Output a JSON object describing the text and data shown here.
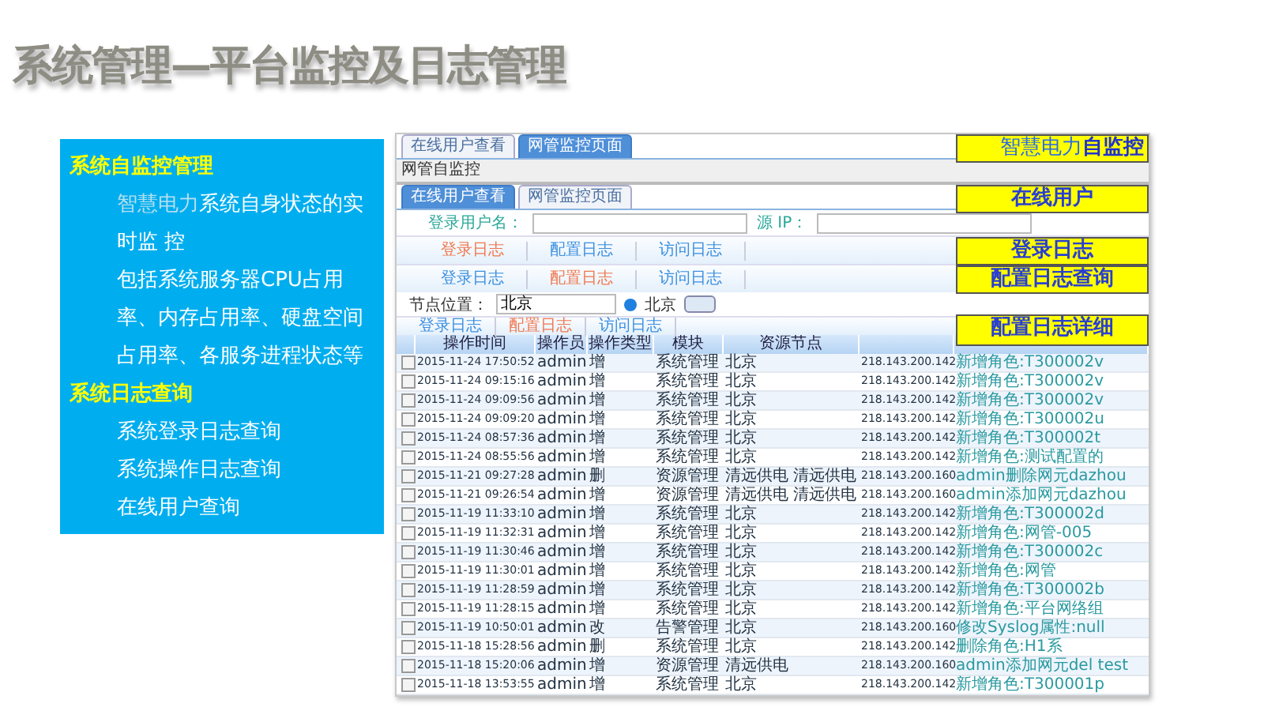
{
  "title": "系统管理—平台监控及日志管理",
  "panel": {
    "sections": [
      {
        "heading": "系统自监控管理",
        "items": [
          {
            "highlight": "智慧电力",
            "text": "系统自身状态的实时监 控"
          },
          {
            "text": "包括系统服务器CPU占用率、内存占用率、硬盘空间占用率、各服务进程状态等"
          }
        ]
      },
      {
        "heading": "系统日志查询",
        "items": [
          {
            "text": "系统登录日志查询"
          },
          {
            "text": "系统操作日志查询"
          },
          {
            "text": "在线用户查询"
          }
        ]
      }
    ]
  },
  "screenshot": {
    "top_tabs": {
      "tabs": [
        {
          "label": "在线用户查看",
          "selected": false
        },
        {
          "label": "网管监控页面",
          "selected": true
        }
      ],
      "callout": "智慧电力**自监控**"
    },
    "breadcrumb": "网管自监控",
    "sub_tabs": {
      "tabs": [
        {
          "label": "在线用户查看",
          "selected": true
        },
        {
          "label": "网管监控页面",
          "selected": false
        }
      ],
      "callout": "在线用户"
    },
    "filters": [
      {
        "label": "登录用户名："
      },
      {
        "label": "源 IP："
      }
    ],
    "log_tabs_1": {
      "tabs": [
        {
          "label": "登录日志",
          "selected": true
        },
        {
          "label": "配置日志",
          "selected": false
        },
        {
          "label": "访问日志",
          "selected": false
        }
      ],
      "callout": "登录日志"
    },
    "log_tabs_2": {
      "tabs": [
        {
          "label": "登录日志",
          "selected": false
        },
        {
          "label": "配置日志",
          "selected": true
        },
        {
          "label": "访问日志",
          "selected": false
        }
      ],
      "callout": "配置日志查询"
    },
    "location": {
      "label": "节点位置：",
      "value": "北京",
      "option": "北京",
      "selected": true
    },
    "log_tabs_3": {
      "tabs": [
        {
          "label": "登录日志",
          "selected": false
        },
        {
          "label": "配置日志",
          "selected": true
        },
        {
          "label": "访问日志",
          "selected": false
        }
      ],
      "callout": "配置日志详细"
    },
    "table": {
      "columns": [
        "操作时间",
        "操作员",
        "操作类型",
        "模块",
        "资源节点"
      ],
      "rows": [
        {
          "checked": false,
          "cells": [
            "2015-11-24 17:50:52",
            "admin",
            "增",
            "系统管理",
            "北京",
            "218.143.200.142",
            "新增角色:T300002v"
          ]
        },
        {
          "checked": false,
          "cells": [
            "2015-11-24 09:15:16",
            "admin",
            "增",
            "系统管理",
            "北京",
            "218.143.200.142",
            "新增角色:T300002v"
          ]
        },
        {
          "checked": false,
          "cells": [
            "2015-11-24 09:09:56",
            "admin",
            "增",
            "系统管理",
            "北京",
            "218.143.200.142",
            "新增角色:T300002v"
          ]
        },
        {
          "checked": false,
          "cells": [
            "2015-11-24 09:09:20",
            "admin",
            "增",
            "系统管理",
            "北京",
            "218.143.200.142",
            "新增角色:T300002u"
          ]
        },
        {
          "checked": false,
          "cells": [
            "2015-11-24 08:57:36",
            "admin",
            "增",
            "系统管理",
            "北京",
            "218.143.200.142",
            "新增角色:T300002t"
          ]
        },
        {
          "checked": false,
          "cells": [
            "2015-11-24 08:55:56",
            "admin",
            "增",
            "系统管理",
            "北京",
            "218.143.200.142",
            "新增角色:测试配置的"
          ]
        },
        {
          "checked": false,
          "cells": [
            "2015-11-21 09:27:28",
            "admin",
            "删",
            "资源管理",
            "清远供电 清远供电",
            "218.143.200.160",
            "admin删除网元dazhou"
          ]
        },
        {
          "checked": false,
          "cells": [
            "2015-11-21 09:26:54",
            "admin",
            "增",
            "资源管理",
            "清远供电 清远供电",
            "218.143.200.160",
            "admin添加网元dazhou"
          ]
        },
        {
          "checked": false,
          "cells": [
            "2015-11-19 11:33:10",
            "admin",
            "增",
            "系统管理",
            "北京",
            "218.143.200.142",
            "新增角色:T300002d"
          ]
        },
        {
          "checked": false,
          "cells": [
            "2015-11-19 11:32:31",
            "admin",
            "增",
            "系统管理",
            "北京",
            "218.143.200.142",
            "新增角色:网管-005"
          ]
        },
        {
          "checked": false,
          "cells": [
            "2015-11-19 11:30:46",
            "admin",
            "增",
            "系统管理",
            "北京",
            "218.143.200.142",
            "新增角色:T300002c"
          ]
        },
        {
          "checked": false,
          "cells": [
            "2015-11-19 11:30:01",
            "admin",
            "增",
            "系统管理",
            "北京",
            "218.143.200.142",
            "新增角色:网管"
          ]
        },
        {
          "checked": false,
          "cells": [
            "2015-11-19 11:28:59",
            "admin",
            "增",
            "系统管理",
            "北京",
            "218.143.200.142",
            "新增角色:T300002b"
          ]
        },
        {
          "checked": false,
          "cells": [
            "2015-11-19 11:28:15",
            "admin",
            "增",
            "系统管理",
            "北京",
            "218.143.200.142",
            "新增角色:平台网络组"
          ]
        },
        {
          "checked": false,
          "cells": [
            "2015-11-19 10:50:01",
            "admin",
            "改",
            "告警管理",
            "北京",
            "218.143.200.160",
            "修改Syslog属性:null"
          ]
        },
        {
          "checked": false,
          "cells": [
            "2015-11-18 15:28:56",
            "admin",
            "删",
            "系统管理",
            "北京",
            "218.143.200.142",
            "删除角色:H1系"
          ]
        },
        {
          "checked": false,
          "cells": [
            "2015-11-18 15:20:06",
            "admin",
            "增",
            "资源管理",
            "清远供电",
            "218.143.200.160",
            "admin添加网元del test"
          ]
        },
        {
          "checked": false,
          "cells": [
            "2015-11-18 13:53:55",
            "admin",
            "增",
            "系统管理",
            "北京",
            "218.143.200.142",
            "新增角色:T300001p"
          ]
        }
      ]
    }
  }
}
